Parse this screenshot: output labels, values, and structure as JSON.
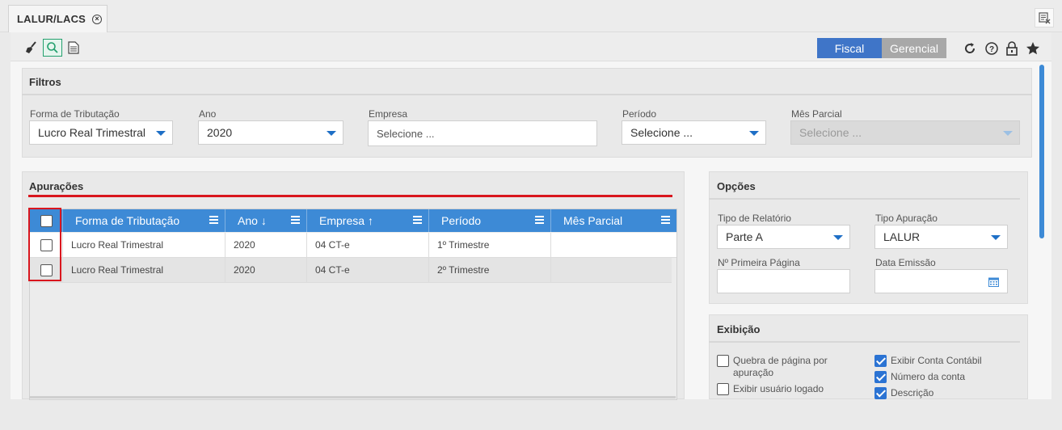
{
  "tab": {
    "label": "LALUR/LACS",
    "close_icon": "close-circle-icon"
  },
  "corner": {
    "icon": "report-export-icon"
  },
  "toolbar": {
    "tools": [
      "broom-icon",
      "search-icon",
      "document-icon"
    ],
    "segments": [
      "Fiscal",
      "Gerencial"
    ],
    "active_segment": "Fiscal",
    "right_icons": [
      "refresh-icon",
      "help-icon",
      "lock-icon",
      "star-icon"
    ]
  },
  "filters": {
    "title": "Filtros",
    "fields": [
      {
        "label": "Forma de Tributação",
        "value": "Lucro Real Trimestral"
      },
      {
        "label": "Ano",
        "value": "2020"
      },
      {
        "label": "Empresa",
        "placeholder": "Selecione ..."
      },
      {
        "label": "Período",
        "value": "Selecione ..."
      },
      {
        "label": "Mês Parcial",
        "value": "Selecione ...",
        "disabled": true
      }
    ]
  },
  "apuracoes": {
    "title": "Apurações",
    "columns": [
      "Forma de Tributação",
      "Ano",
      "Empresa",
      "Período",
      "Mês Parcial"
    ],
    "sort_indicators": {
      "Ano": "↓",
      "Empresa": "↑"
    },
    "rows": [
      {
        "forma": "Lucro Real Trimestral",
        "ano": "2020",
        "empresa": "04 CT-e",
        "periodo": "1º Trimestre",
        "mes_parcial": ""
      },
      {
        "forma": "Lucro Real Trimestral",
        "ano": "2020",
        "empresa": "04 CT-e",
        "periodo": "2º Trimestre",
        "mes_parcial": ""
      }
    ]
  },
  "opcoes": {
    "title": "Opções",
    "tipo_relatorio": {
      "label": "Tipo de Relatório",
      "value": "Parte A"
    },
    "tipo_apuracao": {
      "label": "Tipo Apuração",
      "value": "LALUR"
    },
    "primeira_pagina": {
      "label": "Nº Primeira Página",
      "value": ""
    },
    "data_emissao": {
      "label": "Data Emissão",
      "value": "",
      "icon": "calendar-icon"
    }
  },
  "exibicao": {
    "title": "Exibição",
    "left": [
      {
        "label": "Quebra de página por apuração",
        "checked": false
      },
      {
        "label": "Exibir usuário logado",
        "checked": false
      }
    ],
    "right": [
      {
        "label": "Exibir Conta Contábil",
        "checked": true
      },
      {
        "label": "Número da conta",
        "checked": true
      },
      {
        "label": "Descrição",
        "checked": true
      }
    ]
  },
  "colors": {
    "accent": "#3d8ad6",
    "fiscal": "#3f75c8",
    "highlight": "#d9161e"
  }
}
